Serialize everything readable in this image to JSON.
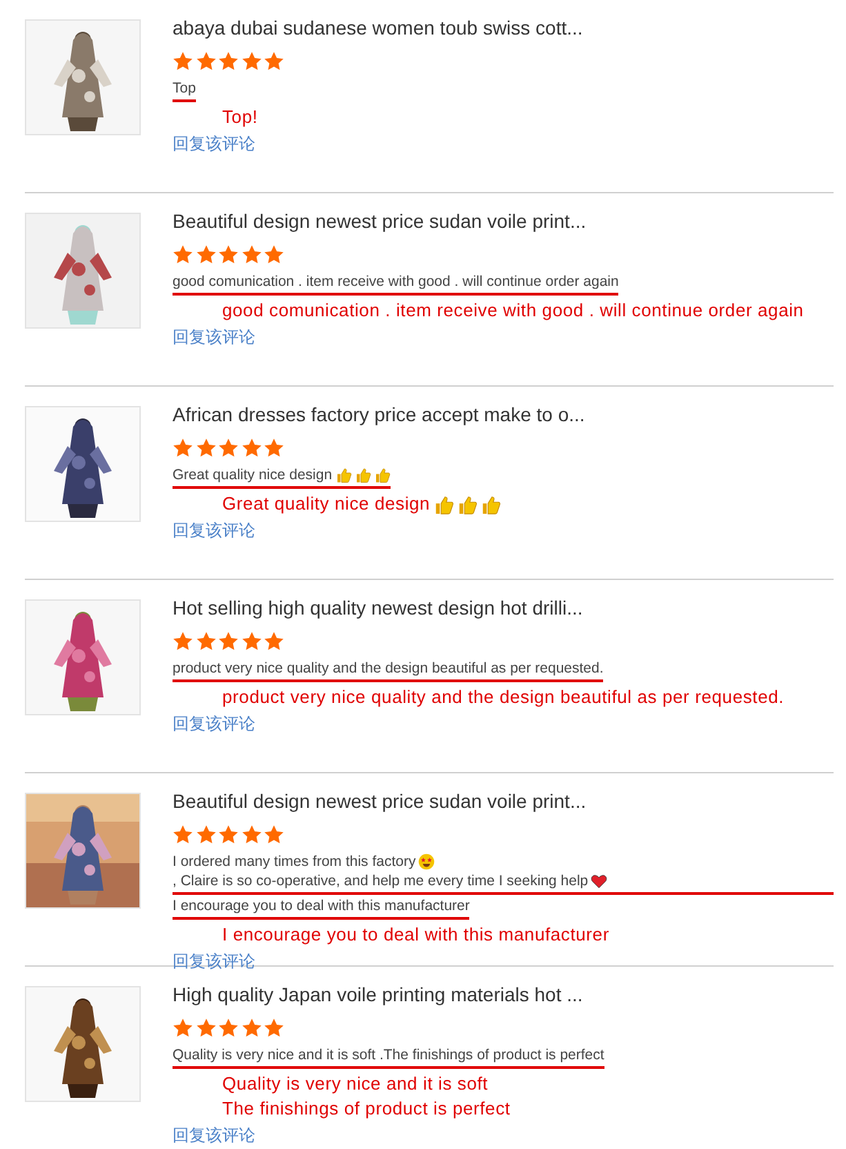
{
  "reviews": [
    {
      "photo": {
        "kind": "picture"
      },
      "product_title": "abaya dubai sudanese women toub swiss cott...",
      "stars": 5,
      "comment": [
        [
          {
            "kind": "text",
            "text": "Top"
          }
        ]
      ],
      "annotation": [
        [
          {
            "kind": "text",
            "text": "Top!"
          }
        ]
      ],
      "reply_link": "回复该评论"
    },
    {
      "photo": {
        "kind": "picture"
      },
      "product_title": "Beautiful design newest price sudan voile print...",
      "stars": 5,
      "comment": [
        [
          {
            "kind": "text",
            "text": "good comunication . item receive with good . will continue order again"
          }
        ]
      ],
      "annotation": [
        [
          {
            "kind": "text",
            "text": "good comunication . item receive with good . will continue order again"
          }
        ]
      ],
      "reply_link": "回复该评论"
    },
    {
      "photo": {
        "kind": "picture"
      },
      "product_title": "African dresses factory price accept make to o...",
      "stars": 5,
      "comment": [
        [
          {
            "kind": "text",
            "text": "Great quality nice design"
          },
          {
            "kind": "thumb"
          },
          {
            "kind": "thumb"
          },
          {
            "kind": "thumb"
          }
        ]
      ],
      "annotation": [
        [
          {
            "kind": "text",
            "text": "Great quality nice design"
          },
          {
            "kind": "thumb"
          },
          {
            "kind": "thumb"
          },
          {
            "kind": "thumb"
          }
        ]
      ],
      "reply_link": "回复该评论"
    },
    {
      "photo": {
        "kind": "picture"
      },
      "product_title": "Hot selling high quality newest design hot drilli...",
      "stars": 5,
      "comment": [
        [
          {
            "kind": "text",
            "text": "product very nice quality and the design beautiful as per requested."
          }
        ]
      ],
      "annotation": [
        [
          {
            "kind": "text",
            "text": "product very nice quality and the design beautiful as per requested."
          }
        ]
      ],
      "reply_link": "回复该评论"
    },
    {
      "photo": {
        "kind": "picture"
      },
      "product_title": "Beautiful design newest price sudan voile print...",
      "stars": 5,
      "comment": [
        [
          {
            "kind": "text",
            "text": "I ordered many times from this factory"
          },
          {
            "kind": "starface"
          },
          {
            "kind": "text",
            "text": ", Claire is so co-operative, and help me every time I seeking  help"
          },
          {
            "kind": "heart"
          }
        ],
        [
          {
            "kind": "text",
            "text": "I encourage you to deal with this manufacturer"
          }
        ]
      ],
      "annotation": [
        [
          {
            "kind": "text",
            "text": "I encourage you to deal with this manufacturer"
          }
        ]
      ],
      "reply_link": "回复该评论"
    },
    {
      "photo": {
        "kind": "picture"
      },
      "product_title": "High quality Japan voile printing materials hot ...",
      "stars": 5,
      "comment": [
        [
          {
            "kind": "text",
            "text": "Quality is very nice and it is soft .The finishings  of product is perfect"
          }
        ]
      ],
      "annotation": [
        [
          {
            "kind": "text",
            "text": "Quality is very nice and it is soft"
          }
        ],
        [
          {
            "kind": "text",
            "text": "The finishings  of product is perfect"
          }
        ]
      ],
      "reply_link": "回复该评论"
    }
  ]
}
